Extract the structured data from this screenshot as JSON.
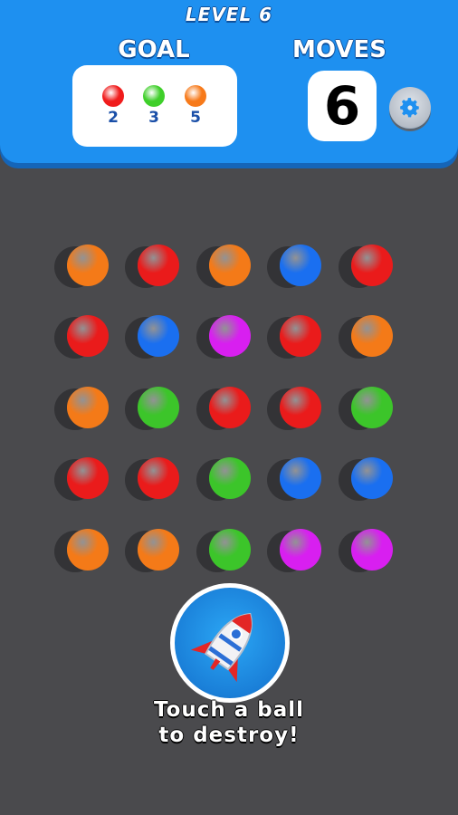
{
  "header": {
    "level_label": "LEVEL 6",
    "goal_label": "GOAL",
    "moves_label": "MOVES",
    "moves_value": "6"
  },
  "goal": [
    {
      "color": "#f01c1c",
      "count": "2"
    },
    {
      "color": "#3fcf2a",
      "count": "3"
    },
    {
      "color": "#f77a1a",
      "count": "5"
    }
  ],
  "board": {
    "colors": {
      "orange": "#f47a18",
      "red": "#ea1b1b",
      "blue": "#1a6ff0",
      "purple": "#d81ff0",
      "green": "#3cc52a"
    },
    "rows": [
      [
        "orange",
        "red",
        "orange",
        "blue",
        "red"
      ],
      [
        "red",
        "blue",
        "purple",
        "red",
        "orange"
      ],
      [
        "orange",
        "green",
        "red",
        "red",
        "green"
      ],
      [
        "red",
        "red",
        "green",
        "blue",
        "blue"
      ],
      [
        "orange",
        "orange",
        "green",
        "purple",
        "purple"
      ]
    ]
  },
  "powerup": {
    "icon": "rocket-icon"
  },
  "hint": {
    "line1": "Touch a ball",
    "line2": "to destroy!"
  }
}
